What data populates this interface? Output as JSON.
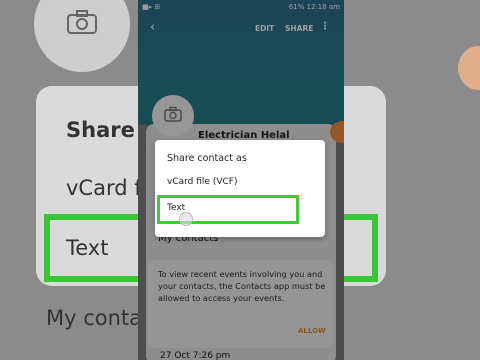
{
  "status_bar": {
    "left": "■▸ ⊞",
    "right": "61% 12:18 am",
    "battery": "61%",
    "time": "12:18 am"
  },
  "header": {
    "back_icon": "back-arrow-icon",
    "edit_label": "EDIT",
    "share_label": "SHARE",
    "more_icon": "more-vert-icon",
    "more_glyph": "⋮",
    "back_glyph": "‹"
  },
  "contact": {
    "name": "Electrician Helal",
    "my_contacts": "My contacts"
  },
  "info": {
    "text": "To view recent events involving you and your contacts, the Contacts app must be allowed to access your events.",
    "allow_label": "ALLOW",
    "event_text": "27 Oct 7:26 pm"
  },
  "dialog": {
    "title": "Share contact as",
    "options": [
      "vCard file (VCF)",
      "Text"
    ]
  },
  "background": {
    "share_text": "Share c",
    "vcard_text": "vCard fi",
    "text_option": "Text",
    "my_contacts": "My conta"
  },
  "colors": {
    "header": "#2d6f88",
    "highlight_green": "#36d12e",
    "accent_orange": "#f08a3e"
  }
}
